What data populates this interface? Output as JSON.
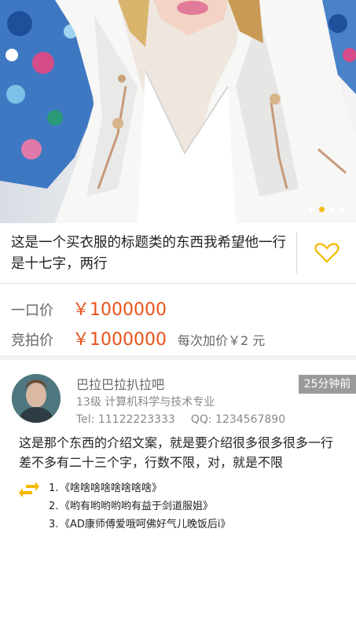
{
  "gallery": {
    "slide_count": 4,
    "active_index": 1,
    "colors": {
      "indicator_active": "#f5b800",
      "indicator_inactive": "#ffffff"
    }
  },
  "item": {
    "title": "这是一个买衣服的标题类的东西我希望他一行是十七字，两行",
    "favorite_icon": "heart-outline-icon"
  },
  "pricing": {
    "fixed_label": "一口价",
    "fixed_price": "￥1000000",
    "bid_label": "竞拍价",
    "bid_price": "￥1000000",
    "increment_text": "每次加价￥2 元",
    "accent_color": "#e8531c"
  },
  "seller": {
    "name": "巴拉巴拉扒拉吧",
    "major": "13级 计算机科学与技术专业",
    "tel": "Tel: 11122223333",
    "qq": "QQ: 1234567890",
    "posted_ago": "25分钟前"
  },
  "description": "这是那个东西的介绍文案，就是要介绍很多很多很多一行差不多有二十三个字，行数不限，对，就是不限",
  "links": {
    "icon": "swap-arrows-icon",
    "items": [
      {
        "num": "1.",
        "text": "《啥啥啥啥啥啥啥啥》"
      },
      {
        "num": "2.",
        "text": "《哟有哟哟哟哟有益于剑道服姐》"
      },
      {
        "num": "3.",
        "text": "《AD康师傅爱哦呵佛好气儿晚饭后i》"
      }
    ]
  }
}
